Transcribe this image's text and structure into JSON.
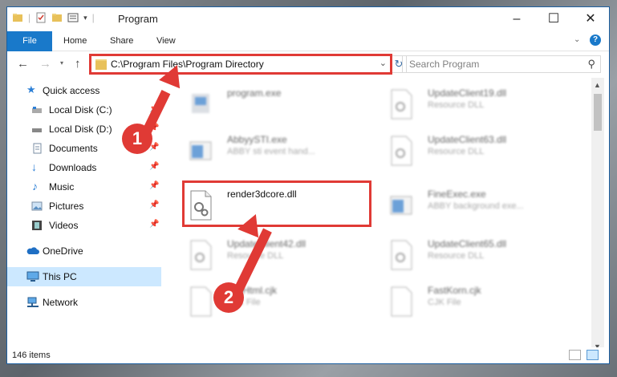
{
  "window": {
    "title": "Program"
  },
  "ribbon": {
    "tabs": [
      "File",
      "Home",
      "Share",
      "View"
    ]
  },
  "navbar": {
    "address": "C:\\Program Files\\Program Directory",
    "search_placeholder": "Search Program"
  },
  "sidebar": {
    "items": [
      {
        "label": "Quick access",
        "icon": "star-icon"
      },
      {
        "label": "Local Disk (C:)",
        "icon": "drive-icon"
      },
      {
        "label": "Local Disk (D:)",
        "icon": "drive-icon"
      },
      {
        "label": "Documents",
        "icon": "documents-icon"
      },
      {
        "label": "Downloads",
        "icon": "download-arrow-icon"
      },
      {
        "label": "Music",
        "icon": "music-note-icon"
      },
      {
        "label": "Pictures",
        "icon": "pictures-icon"
      },
      {
        "label": "Videos",
        "icon": "film-icon"
      },
      {
        "label": "OneDrive",
        "icon": "cloud-icon"
      },
      {
        "label": "This PC",
        "icon": "computer-icon",
        "selected": true
      },
      {
        "label": "Network",
        "icon": "network-icon"
      }
    ]
  },
  "files": [
    {
      "name": "program.exe",
      "type": ""
    },
    {
      "name": "AbbyySTI.exe",
      "type": "ABBY sti event hand..."
    },
    {
      "name": "render3dcore.dll",
      "type": ""
    },
    {
      "name": "UpdateClient42.dll",
      "type": "Resource DLL"
    },
    {
      "name": "FileHtml.cjk",
      "type": "CJK File"
    },
    {
      "name": "UpdateClient19.dll",
      "type": "Resource DLL"
    },
    {
      "name": "UpdateClient63.dll",
      "type": "Resource DLL"
    },
    {
      "name": "FineExec.exe",
      "type": "ABBY background exe..."
    },
    {
      "name": "UpdateClient65.dll",
      "type": "Resource DLL"
    },
    {
      "name": "FastKorn.cjk",
      "type": "CJK File"
    }
  ],
  "status": {
    "item_count": "146 items"
  },
  "annotations": {
    "step1": "1",
    "step2": "2"
  },
  "colors": {
    "accent": "#1979ca",
    "annotation": "#e03a35",
    "selection": "#cce8ff"
  }
}
